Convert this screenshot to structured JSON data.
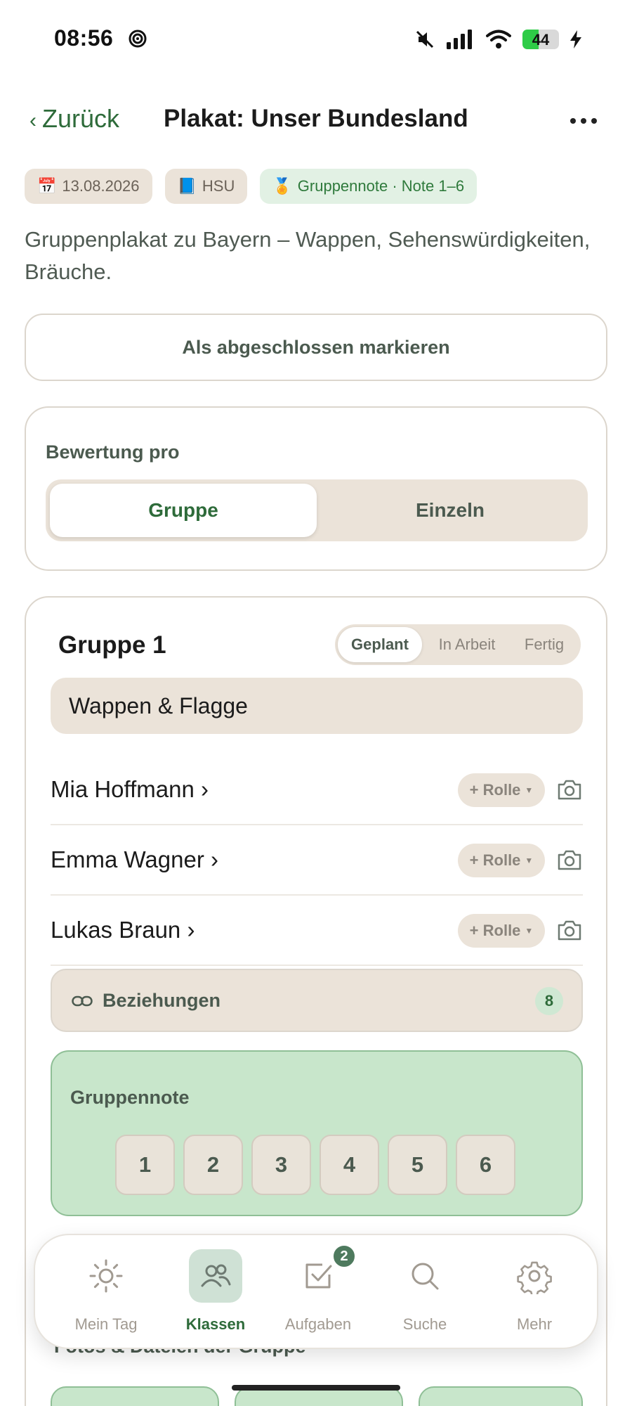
{
  "status_bar": {
    "time": "08:56",
    "battery": "44",
    "battery_level": 0.44
  },
  "nav": {
    "back_label": "Zurück",
    "title": "Plakat: Unser Bundesland"
  },
  "chips": [
    {
      "emoji": "📅",
      "label": "13.08.2026"
    },
    {
      "emoji": "📘",
      "label": "HSU"
    },
    {
      "emoji": "🏅",
      "label": "Gruppennote · Note 1–6"
    }
  ],
  "description": "Gruppenplakat zu Bayern – Wappen, Sehenswürdigkeiten, Bräuche.",
  "complete_button": "Als abgeschlossen markieren",
  "rating": {
    "label": "Bewertung pro",
    "options": [
      "Gruppe",
      "Einzeln"
    ],
    "selected": "Gruppe"
  },
  "group": {
    "title": "Gruppe 1",
    "status_options": [
      "Geplant",
      "In Arbeit",
      "Fertig"
    ],
    "status_selected": "Geplant",
    "topic": "Wappen & Flagge",
    "members": [
      {
        "name": "Mia Hoffmann ›",
        "role": "+ Rolle"
      },
      {
        "name": "Emma Wagner ›",
        "role": "+ Rolle"
      },
      {
        "name": "Lukas Braun ›",
        "role": "+ Rolle"
      }
    ],
    "relations": {
      "label": "Beziehungen",
      "count": "8"
    },
    "grade": {
      "label": "Gruppennote",
      "options": [
        "1",
        "2",
        "3",
        "4",
        "5",
        "6"
      ]
    },
    "files_label": "Fotos & Dateien der Gruppe"
  },
  "tab_bar": {
    "tabs": [
      {
        "label": "Mein Tag",
        "icon": "sun-icon"
      },
      {
        "label": "Klassen",
        "icon": "people-icon",
        "active": true
      },
      {
        "label": "Aufgaben",
        "icon": "checkbox-icon",
        "badge": "2"
      },
      {
        "label": "Suche",
        "icon": "search-icon"
      },
      {
        "label": "Mehr",
        "icon": "gear-icon"
      }
    ]
  },
  "colors": {
    "accent": "#2e6b3a",
    "beige": "#ebe3d9",
    "green_soft": "#c8e6cb"
  }
}
